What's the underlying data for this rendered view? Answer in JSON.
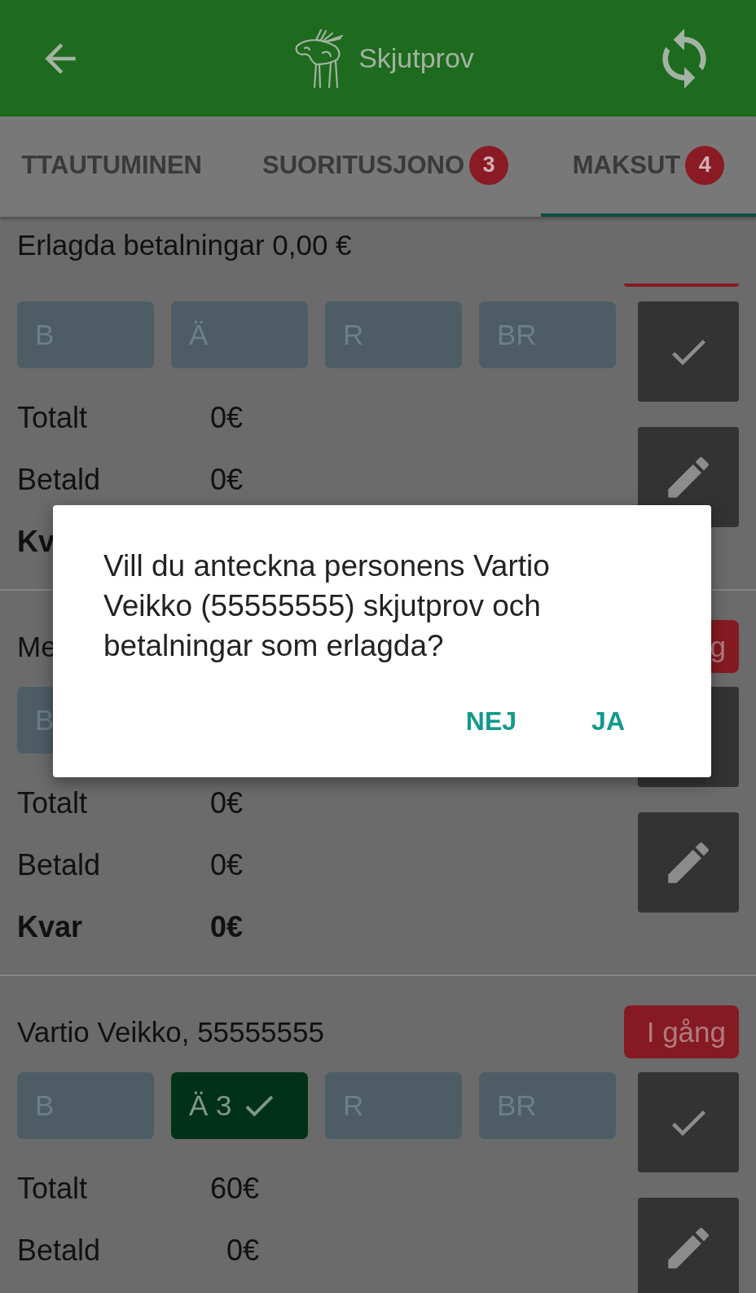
{
  "app_bar": {
    "title": "Skjutprov"
  },
  "tabs": [
    {
      "label": "TTAUTUMINEN",
      "selected": false
    },
    {
      "label": "SUORITUSJONO",
      "badge": "3",
      "selected": false
    },
    {
      "label": "MAKSUT",
      "badge": "4",
      "selected": true
    }
  ],
  "summary": "Erlagda betalningar 0,00 €",
  "payments": [
    {
      "status_sliver": true,
      "chips": [
        {
          "label": "B",
          "selected": false
        },
        {
          "label": "Ä",
          "selected": false
        },
        {
          "label": "R",
          "selected": false
        },
        {
          "label": "BR",
          "selected": false
        }
      ],
      "amounts": [
        {
          "kind": "line",
          "label": "Totalt",
          "value": "0€"
        },
        {
          "kind": "line",
          "label": "Betald",
          "value": "0€"
        },
        {
          "kind": "sum",
          "label": "Kv"
        }
      ],
      "actions": [
        {
          "kind": "confirm"
        },
        {
          "kind": "edit"
        }
      ]
    },
    {
      "name": "Me",
      "status": "g",
      "chips": [
        {
          "label": "B",
          "selected": false
        }
      ],
      "amounts": [
        {
          "kind": "line",
          "label": "Totalt",
          "value": "0€"
        },
        {
          "kind": "line",
          "label": "Betald",
          "value": "0€"
        },
        {
          "kind": "sum",
          "label": "Kvar",
          "value": "0€"
        }
      ],
      "actions": [
        {
          "kind": "confirm"
        },
        {
          "kind": "edit"
        }
      ]
    },
    {
      "name": "Vartio Veikko, 55555555",
      "status": "I gång",
      "chips": [
        {
          "label": "B",
          "selected": false
        },
        {
          "label": "Ä 3",
          "selected": true
        },
        {
          "label": "R",
          "selected": false
        },
        {
          "label": "BR",
          "selected": false
        }
      ],
      "amounts": [
        {
          "kind": "line",
          "label": "Totalt",
          "value": "60€"
        },
        {
          "kind": "line",
          "label": "Betald",
          "value": "0€"
        }
      ],
      "actions": [
        {
          "kind": "confirm"
        },
        {
          "kind": "edit"
        }
      ]
    }
  ],
  "dialog": {
    "message": "Vill du anteckna personens Vartio Veikko (55555555) skjutprov och betalningar som erlagda?",
    "buttons": [
      "NEJ",
      "JA"
    ]
  }
}
